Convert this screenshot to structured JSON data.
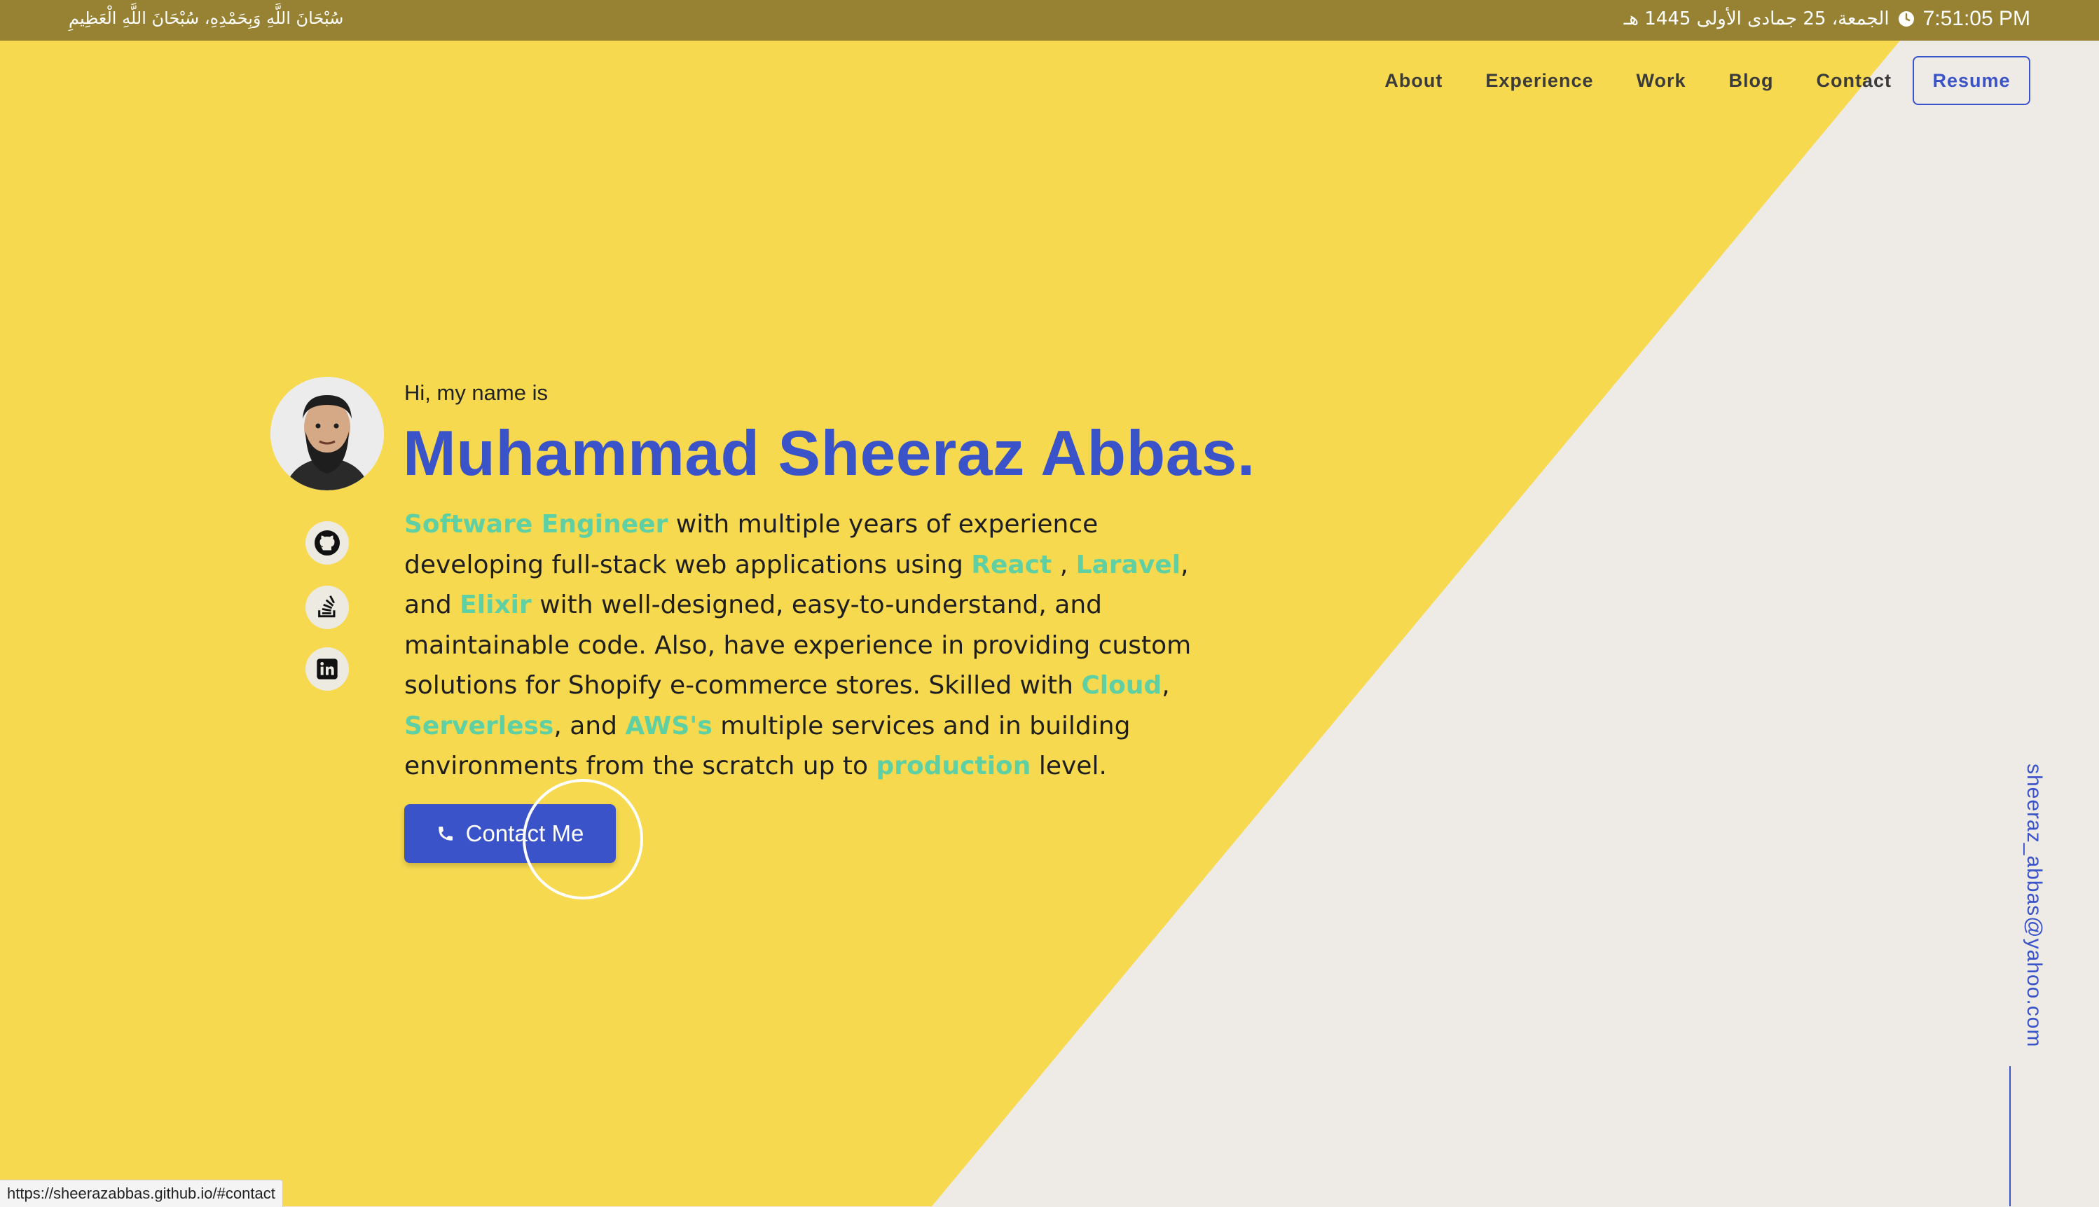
{
  "topbar": {
    "dhikr": "سُبْحَانَ اللَّهِ وَبِحَمْدِهِ، سُبْحَانَ اللَّهِ الْعَظِيمِ",
    "hijri_date": "الجمعة، 25 جمادى الأولى 1445 هـ",
    "time": "7:51:05 PM",
    "clock_icon": "clock-icon"
  },
  "nav": {
    "about": "About",
    "experience": "Experience",
    "work": "Work",
    "blog": "Blog",
    "contact": "Contact",
    "resume": "Resume"
  },
  "hero": {
    "greeting": "Hi, my name is",
    "name": "Muhammad Sheeraz Abbas.",
    "intro": {
      "t1": "Software Engineer",
      "t2": " with multiple years of experience developing full-stack web applications using ",
      "t3": "React",
      "t4": " , ",
      "t5": "Laravel",
      "t6": ", and ",
      "t7": "Elixir",
      "t8": " with well-designed, easy-to-understand, and maintainable code. Also, have experience in providing custom solutions for Shopify e-commerce stores. Skilled with ",
      "t9": "Cloud",
      "t10": ", ",
      "t11": "Serverless",
      "t12": ", and ",
      "t13": "AWS's",
      "t14": " multiple services and in building environments from the scratch up to ",
      "t15": "production",
      "t16": " level."
    },
    "contact_button": "Contact Me",
    "contact_icon": "phone-icon"
  },
  "social": [
    {
      "icon": "github-icon"
    },
    {
      "icon": "stackoverflow-icon"
    },
    {
      "icon": "linkedin-icon"
    }
  ],
  "email": "sheeraz_abbas@yahoo.com",
  "status_url": "https://sheerazabbas.github.io/#contact",
  "colors": {
    "yellow": "#F7D94F",
    "beige": "#EEEBE6",
    "topbar": "#978133",
    "accent_blue": "#3A53C9",
    "highlight_green": "#5FD0A3"
  }
}
